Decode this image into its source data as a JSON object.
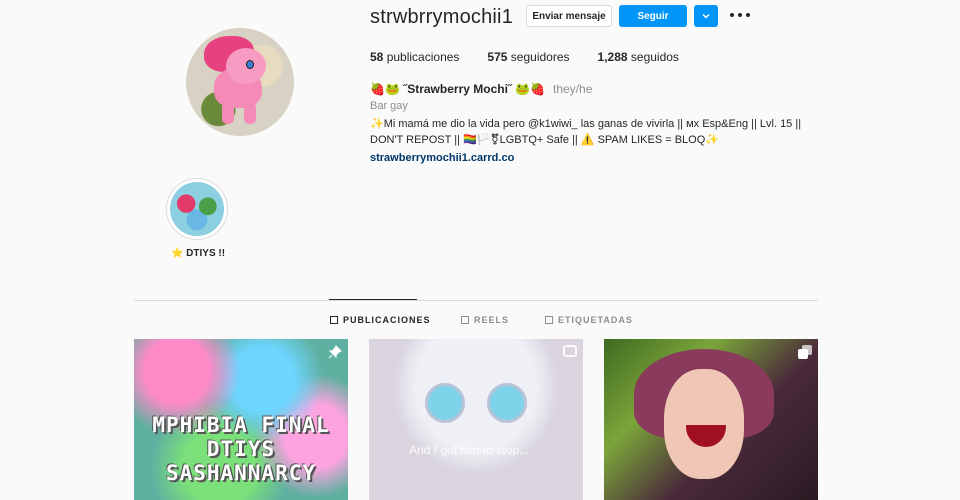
{
  "profile": {
    "username": "strwbrrymochii1",
    "buttons": {
      "message": "Enviar mensaje",
      "follow": "Seguir",
      "dropdown": "⌄"
    },
    "stats": {
      "posts_count": "58",
      "posts_label": "publicaciones",
      "followers_count": "575",
      "followers_label": "seguidores",
      "following_count": "1,288",
      "following_label": "seguidos"
    },
    "full_name": "🍓🐸 ˝Strawberry Mochi˝ 🐸🍓",
    "pronouns": "they/he",
    "category": "Bar gay",
    "bio": "✨Mi mamá me dio la vida pero @k1wiwi_ las ganas de vivirla || ᴍx Esp&Eng || Lvl. 15 || DON'T REPOST || 🏳️‍🌈🏳️⚧LGBTQ+ Safe || ⚠️ SPAM LIKES = BLOQ✨",
    "link": "strawberrymochii1.carrd.co"
  },
  "highlights": [
    {
      "label": "⭐ DTIYS !!"
    }
  ],
  "tabs": {
    "posts": "PUBLICACIONES",
    "reels": "REELS",
    "tagged": "ETIQUETADAS"
  },
  "posts": [
    {
      "lines": [
        "MPHIBIA FINAL",
        "DTIYS",
        "SASHANNARCY"
      ]
    },
    {
      "caption": "And I got him to stop..."
    },
    {
      "caption": ""
    }
  ],
  "colors": {
    "accent": "#0095f6",
    "link": "#00376b",
    "text": "#262626",
    "muted": "#8e8e8e"
  }
}
